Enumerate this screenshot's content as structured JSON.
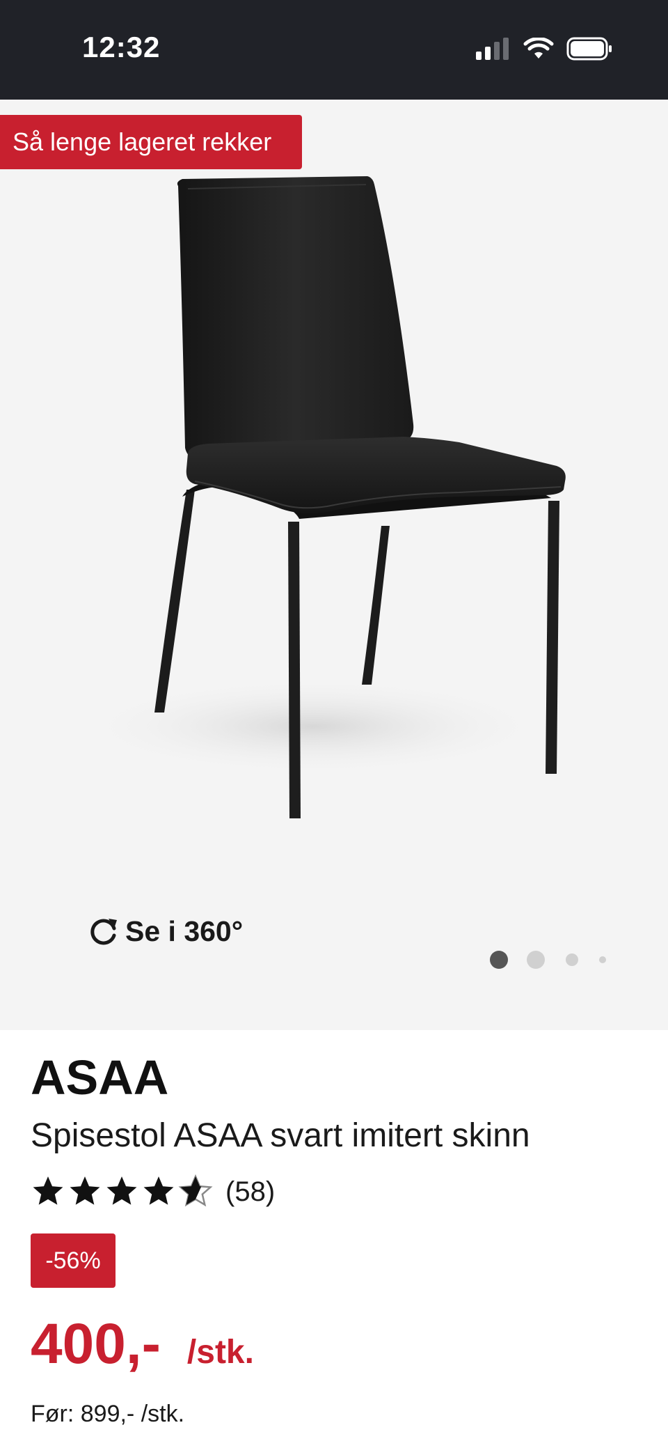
{
  "status_bar": {
    "time": "12:32",
    "icons": [
      "signal-icon",
      "wifi-icon",
      "battery-icon"
    ]
  },
  "gallery": {
    "stock_badge": "Så lenge lageret rekker",
    "view_360_label": "Se i 360°",
    "view_360_icon": "rotate-icon",
    "dots_total": 4,
    "active_dot": 1
  },
  "product": {
    "brand": "ASAA",
    "name": "Spisestol ASAA svart imitert skinn",
    "rating": 4.5,
    "rating_max": 5,
    "review_count": "(58)",
    "discount": "-56%",
    "price": "400,-",
    "unit": "/stk.",
    "old_price": "Før: 899,- /stk."
  },
  "colors": {
    "accent": "#c8202f",
    "status_bar_bg": "#202228",
    "image_bg": "#f4f4f4"
  }
}
